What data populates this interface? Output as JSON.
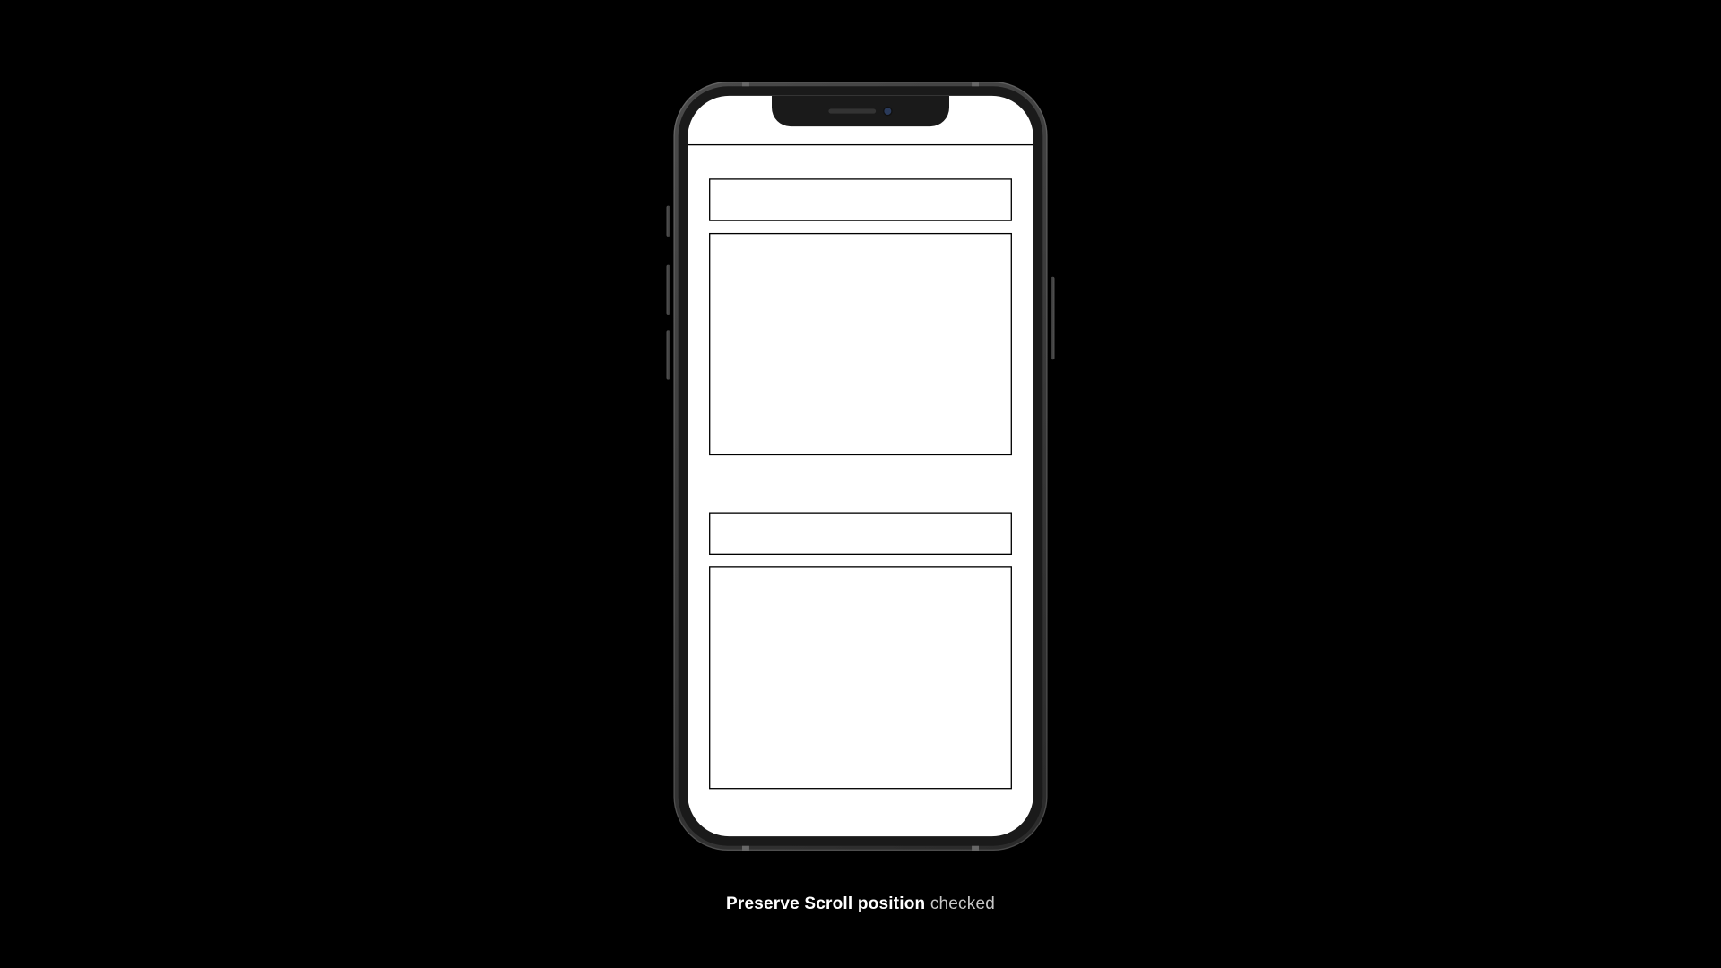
{
  "caption": {
    "bold": "Preserve Scroll position",
    "regular": " checked"
  }
}
